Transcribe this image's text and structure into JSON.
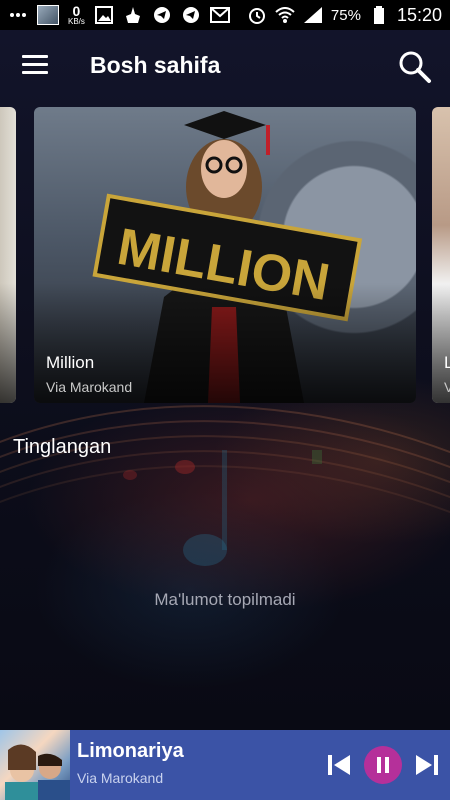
{
  "status_bar": {
    "kb_value": "0",
    "kb_unit": "KB/s",
    "battery": "75%",
    "time": "15:20",
    "icons": [
      "more-icon",
      "user-thumb",
      "image-icon",
      "cleaner-icon",
      "telegram-icon",
      "telegram-icon",
      "mail-icon",
      "alarm-icon",
      "wifi-icon",
      "signal-icon",
      "battery-icon"
    ]
  },
  "app_bar": {
    "title": "Bosh sahifa"
  },
  "carousel": {
    "cards": [
      {
        "title": "",
        "subtitle": ""
      },
      {
        "title": "Million",
        "subtitle": "Via Marokand",
        "image_text": "MILLION"
      },
      {
        "title": "L",
        "subtitle": "V"
      }
    ]
  },
  "section": {
    "title": "Tinglangan",
    "empty_message": "Ma'lumot topilmadi"
  },
  "player": {
    "title": "Limonariya",
    "artist": "Via Marokand",
    "accent_color": "#b5309a",
    "bar_color": "#3b53a6"
  }
}
